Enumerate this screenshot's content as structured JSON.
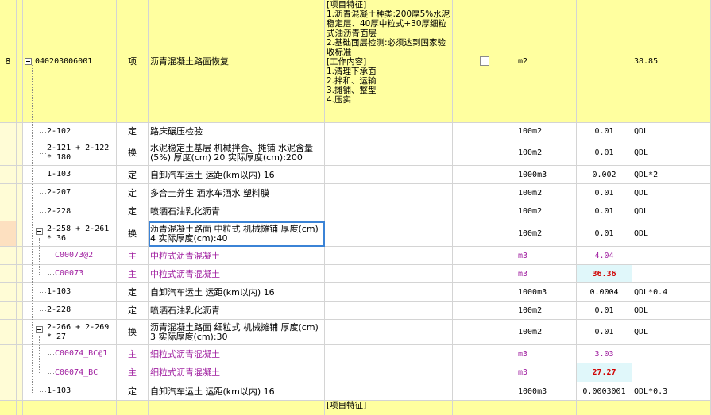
{
  "bill_item": {
    "row_no": "8",
    "code": "040203006001",
    "category": "项",
    "name": "沥青混凝土路面恢复",
    "feature": "[项目特征]\n1.沥青混凝土种类:200厚5%水泥稳定层、40厚中粒式+30厚细粒式油沥青面层\n2.基础面层检测:必须达到国家验收标准\n[工作内容]\n1.清理下承面\n2.拌和、运输\n3.摊铺、整型\n4.压实",
    "unit": "m2",
    "quantity": "",
    "expr": "38.85"
  },
  "sub_rows": [
    {
      "code": "2-102",
      "type": "定",
      "name": "路床碾压检验",
      "unit": "100m2",
      "qty": "0.01",
      "expr": "QDL"
    },
    {
      "code": "2-121 + 2-122 * 180",
      "type": "换",
      "name": "水泥稳定土基层 机械拌合、摊铺 水泥含量(5%) 厚度(cm) 20  实际厚度(cm):200",
      "unit": "100m2",
      "qty": "0.01",
      "expr": "QDL"
    },
    {
      "code": "1-103",
      "type": "定",
      "name": "自卸汽车运土 运距(km以内) 16",
      "unit": "1000m3",
      "qty": "0.002",
      "expr": "QDL*2"
    },
    {
      "code": "2-207",
      "type": "定",
      "name": "多合土养生 洒水车洒水 塑料膜",
      "unit": "100m2",
      "qty": "0.01",
      "expr": "QDL"
    },
    {
      "code": "2-228",
      "type": "定",
      "name": "喷洒石油乳化沥青",
      "unit": "100m2",
      "qty": "0.01",
      "expr": "QDL"
    },
    {
      "code": "2-258 + 2-261 * 36",
      "type": "换",
      "name": "沥青混凝土路面 中粒式 机械摊铺 厚度(cm) 4  实际厚度(cm):40",
      "unit": "100m2",
      "qty": "0.01",
      "expr": "QDL"
    },
    {
      "code": "C00073@2",
      "type": "主",
      "name": "中粒式沥青混凝土",
      "unit": "m3",
      "qty": "4.04",
      "expr": ""
    },
    {
      "code": "C00073",
      "type": "主",
      "name": "中粒式沥青混凝土",
      "unit": "m3",
      "qty": "36.36",
      "expr": ""
    },
    {
      "code": "1-103",
      "type": "定",
      "name": "自卸汽车运土 运距(km以内) 16",
      "unit": "1000m3",
      "qty": "0.0004",
      "expr": "QDL*0.4"
    },
    {
      "code": "2-228",
      "type": "定",
      "name": "喷洒石油乳化沥青",
      "unit": "100m2",
      "qty": "0.01",
      "expr": "QDL"
    },
    {
      "code": "2-266 + 2-269 * 27",
      "type": "换",
      "name": "沥青混凝土路面 细粒式 机械摊铺 厚度(cm) 3  实际厚度(cm):30",
      "unit": "100m2",
      "qty": "0.01",
      "expr": "QDL"
    },
    {
      "code": "C00074_BC@1",
      "type": "主",
      "name": "细粒式沥青混凝土",
      "unit": "m3",
      "qty": "3.03",
      "expr": ""
    },
    {
      "code": "C00074_BC",
      "type": "主",
      "name": "细粒式沥青混凝土",
      "unit": "m3",
      "qty": "27.27",
      "expr": ""
    },
    {
      "code": "1-103",
      "type": "定",
      "name": "自卸汽车运土 运距(km以内) 16",
      "unit": "1000m3",
      "qty": "0.0003001",
      "expr": "QDL*0.3"
    }
  ],
  "next_item": {
    "feature": "[项目特征]"
  },
  "colors": {
    "item_bg": "#ffff9f",
    "main_material_text": "#a020a0",
    "highlight_qty": "#d00000",
    "selection_border": "#3b83d6"
  }
}
